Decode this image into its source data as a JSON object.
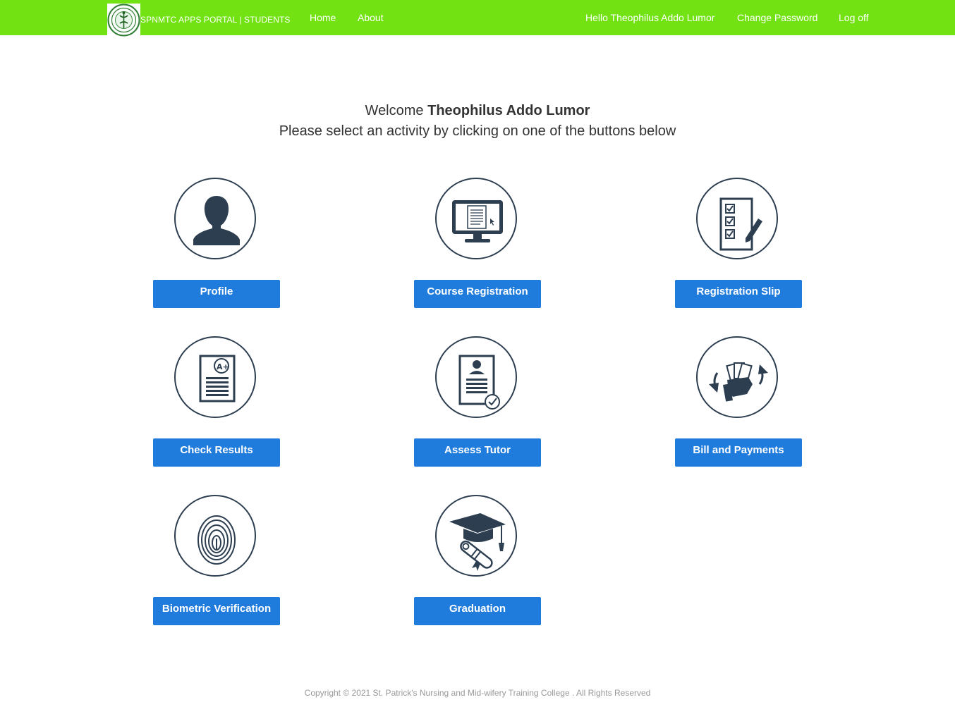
{
  "navbar": {
    "brand": "SPNMTC APPS PORTAL | STUDENTS",
    "logo_icon": "college-seal-icon",
    "background": "#72e213",
    "links": {
      "home": "Home",
      "about": "About",
      "hello": "Hello Theophilus Addo Lumor",
      "change_password": "Change Password",
      "log_off": "Log off"
    }
  },
  "welcome": {
    "prefix": "Welcome",
    "name": "Theophilus Addo Lumor",
    "instruction": "Please select an activity by clicking on one of the buttons below"
  },
  "tiles": [
    {
      "label": "Profile",
      "icon": "user-silhouette-icon"
    },
    {
      "label": "Course Registration",
      "icon": "monitor-document-icon"
    },
    {
      "label": "Registration Slip",
      "icon": "checklist-pencil-icon"
    },
    {
      "label": "Check Results",
      "icon": "graded-report-icon"
    },
    {
      "label": "Assess Tutor",
      "icon": "tutor-profile-check-icon"
    },
    {
      "label": "Bill and Payments",
      "icon": "hand-money-icon"
    },
    {
      "label": "Biometric Verification",
      "icon": "fingerprint-icon"
    },
    {
      "label": "Graduation",
      "icon": "graduation-cap-diploma-icon"
    }
  ],
  "colors": {
    "button": "#1f7bdc",
    "icon": "#2c3e50"
  },
  "footer": {
    "copyright": "Copyright © 2021 St. Patrick's Nursing and Mid-wifery Training College . All Rights Reserved"
  }
}
